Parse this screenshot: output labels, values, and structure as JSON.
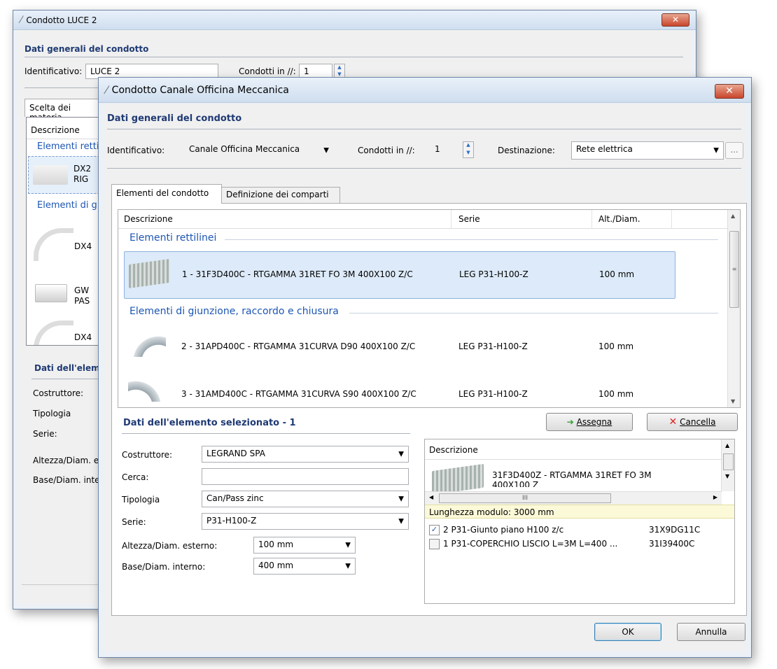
{
  "back_window": {
    "title": "Condotto LUCE 2",
    "section_general": "Dati generali del condotto",
    "id_label": "Identificativo:",
    "id_value": "LUCE 2",
    "parallel_label": "Condotti in //:",
    "parallel_value": "1",
    "tab_label": "Scelta dei materia",
    "col_desc": "Descrizione",
    "group1": "Elementi rettil",
    "item1_line1": "DX2",
    "item1_line2": "RIG",
    "group2": "Elementi di gi",
    "item2": "DX4",
    "item3_line1": "GW",
    "item3_line2": "PAS",
    "item4": "DX4",
    "section_element": "Dati dell'eleme",
    "lbl_costruttore": "Costruttore:",
    "lbl_tipologia": "Tipologia",
    "lbl_serie": "Serie:",
    "lbl_altezza": "Altezza/Diam. es",
    "lbl_base": "Base/Diam. inter"
  },
  "front_window": {
    "title": "Condotto Canale Officina Meccanica",
    "section_general": "Dati generali del condotto",
    "id_label": "Identificativo:",
    "id_value": "Canale Officina Meccanica",
    "parallel_label": "Condotti in //:",
    "parallel_value": "1",
    "dest_label": "Destinazione:",
    "dest_value": "Rete elettrica",
    "more_button": "...",
    "tabs": [
      {
        "label": "Elementi del condotto"
      },
      {
        "label": "Definizione dei comparti"
      }
    ],
    "grid": {
      "columns": [
        "Descrizione",
        "Serie",
        "Alt./Diam."
      ],
      "group1": "Elementi rettilinei",
      "group2": "Elementi di giunzione, raccordo e chiusura",
      "rows": [
        {
          "desc": "1 - 31F3D400C - RTGAMMA 31RET FO 3M 400X100 Z/C",
          "serie": "LEG P31-H100-Z",
          "dim": "100 mm"
        },
        {
          "desc": "2 - 31APD400C - RTGAMMA 31CURVA D90 400X100 Z/C",
          "serie": "LEG P31-H100-Z",
          "dim": "100 mm"
        },
        {
          "desc": "3 - 31AMD400C - RTGAMMA 31CURVA S90 400X100 Z/C",
          "serie": "LEG P31-H100-Z",
          "dim": "100 mm"
        }
      ]
    },
    "section_element": "Dati dell'elemento selezionato - 1",
    "assegna_button": "Assegna",
    "cancella_button": "Cancella",
    "fields": {
      "costruttore_label": "Costruttore:",
      "costruttore_value": "LEGRAND SPA",
      "cerca_label": "Cerca:",
      "cerca_value": "",
      "tipologia_label": "Tipologia",
      "tipologia_value": "Can/Pass zinc",
      "serie_label": "Serie:",
      "serie_value": "P31-H100-Z",
      "altezza_label": "Altezza/Diam. esterno:",
      "altezza_value": "100 mm",
      "base_label": "Base/Diam. interno:",
      "base_value": "400 mm"
    },
    "right_list": {
      "header": "Descrizione",
      "item_line1": "31F3D400Z - RTGAMMA 31RET FO 3M",
      "item_line2": "400X100 Z",
      "hscroll_glyph": "III",
      "module_length": "Lunghezza modulo: 3000 mm",
      "accessories": [
        {
          "checked": true,
          "desc": "2 P31-Giunto piano H100 z/c",
          "code": "31X9DG11C"
        },
        {
          "checked": false,
          "desc": "1 P31-COPERCHIO LISCIO L=3M L=400 ...",
          "code": "31I39400C"
        }
      ]
    },
    "ok_button": "OK",
    "cancel_button": "Annulla"
  }
}
